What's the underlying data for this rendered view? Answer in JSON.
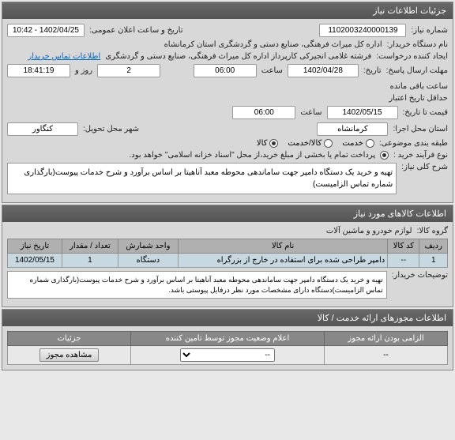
{
  "panels": {
    "needInfo": "جزئیات اطلاعات نیاز",
    "goods": "اطلاعات کالاهای مورد نیاز",
    "licences": "اطلاعات مجوزهای ارائه خدمت / کالا"
  },
  "labels": {
    "needNo": "شماره نیاز:",
    "announceDate": "تاریخ و ساعت اعلان عمومی:",
    "buyerOrg": "نام دستگاه خریدار:",
    "requester": "ایجاد کننده درخواست:",
    "contactLink": "اطلاعات تماس خریدار",
    "deadline": "مهلت ارسال پاسخ:",
    "hour": "ساعت",
    "dayAnd": "روز و",
    "remaining": "ساعت باقی مانده",
    "minValid": "حداقل تاریخ اعتبار",
    "priceUntil": "قیمت تا تاریخ:",
    "execProvince": "استان محل اجرا:",
    "deliveryCity": "شهر محل تحویل:",
    "subjectClass": "طبقه بندی موضوعی:",
    "service": "خدمت",
    "goodsService": "کالا/خدمت",
    "goods": "کالا",
    "buyProcess": "نوع فرآیند خرید :",
    "needSummary": "شرح کلی نیاز:",
    "goodsGroup": "گروه کالا:",
    "buyerNotes": "توضیحات خریدار:",
    "mandatory": "الزامی بودن ارائه مجوز",
    "statusBySupplier": "اعلام وضعیت مجوز توسط تامین کننده",
    "details": "جزئیات",
    "viewLicence": "مشاهده مجوز"
  },
  "values": {
    "needNo": "1102003240000139",
    "announceDate": "1402/04/25 - 10:42",
    "buyerOrg": "اداره کل میراث فرهنگی، صنایع دستی و گردشگری استان کرمانشاه",
    "requester": "فرشته غلامی انجیرکی کارپرداز اداره کل میراث فرهنگی، صنایع دستی و گردشگری",
    "deadlineDate": "1402/04/28",
    "deadlineHour": "06:00",
    "remainDays": "2",
    "remainTime": "18:41:19",
    "validDate": "1402/05/15",
    "validHour": "06:00",
    "province": "کرمانشاه",
    "city": "کنگاور",
    "buyProcessDesc": "پرداخت تمام یا بخشی از مبلغ خرید،از محل \"اسناد خزانه اسلامی\" خواهد بود.",
    "needSummary": "تهیه و خرید یک دستگاه دامپر جهت ساماندهی محوطه معبد آناهیتا بر اساس برآورد و شرح خدمات پیوست(بارگذاری شماره تماس الزامیست)",
    "goodsGroup": "لوازم خودرو و ماشین آلات",
    "buyerNotes": "تهیه و خرید یک دستگاه دامپر جهت ساماندهی محوطه معبد آناهیتا بر اساس برآورد و شرح خدمات پیوست(بارگذاری شماره تماس الزامیست)دستگاه دارای مشخصات مورد نظر درفایل پیوستی باشد."
  },
  "goodsTable": {
    "headers": {
      "row": "ردیف",
      "code": "کد کالا",
      "name": "نام کالا",
      "unit": "واحد شمارش",
      "qty": "تعداد / مقدار",
      "needDate": "تاریخ نیاز"
    },
    "rows": [
      {
        "row": "1",
        "code": "--",
        "name": "دامپر طراحی شده برای استفاده در خارج از بزرگراه",
        "unit": "دستگاه",
        "qty": "1",
        "needDate": "1402/05/15"
      }
    ]
  },
  "licence": {
    "mandatory": "--",
    "status": "--"
  }
}
